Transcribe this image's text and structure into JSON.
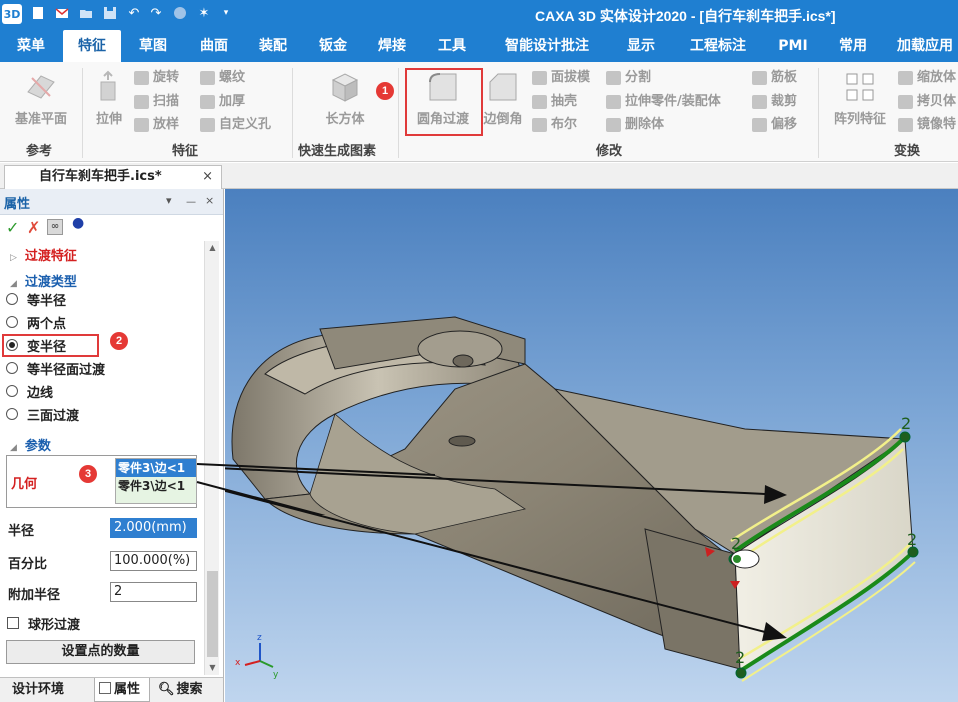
{
  "window": {
    "title": "CAXA 3D 实体设计2020 - [自行车刹车把手.ics*]"
  },
  "quick_access": [
    "new-doc-icon",
    "mail-icon",
    "open-folder-icon",
    "save-icon",
    "undo-icon",
    "redo-icon",
    "globe-icon",
    "sparkle-icon",
    "dropdown-icon"
  ],
  "menu_tabs": [
    {
      "label": "菜单"
    },
    {
      "label": "特征"
    },
    {
      "label": "草图"
    },
    {
      "label": "曲面"
    },
    {
      "label": "装配"
    },
    {
      "label": "钣金"
    },
    {
      "label": "焊接"
    },
    {
      "label": "工具"
    },
    {
      "label": "智能设计批注"
    },
    {
      "label": "显示"
    },
    {
      "label": "工程标注"
    },
    {
      "label": "PMI"
    },
    {
      "label": "常用"
    },
    {
      "label": "加载应用"
    }
  ],
  "active_tab": "特征",
  "ribbon": {
    "reference": {
      "group": "参考",
      "base_plane": "基准平面"
    },
    "feature": {
      "group": "特征",
      "extrude": "拉伸",
      "revolve": "旋转",
      "sweep": "扫描",
      "loft": "放样",
      "thread": "螺纹",
      "thicken": "加厚",
      "custom_hole": "自定义孔"
    },
    "quick": {
      "group": "快速生成图素",
      "box": "长方体"
    },
    "modify": {
      "group": "修改",
      "fillet": "圆角过渡",
      "chamfer": "边倒角",
      "draft": "面拔模",
      "shell": "抽壳",
      "boolean": "布尔",
      "split": "分割",
      "extrude_part": "拉伸零件/装配体",
      "delete_body": "删除体",
      "rib": "筋板",
      "trim": "裁剪",
      "offset": "偏移"
    },
    "transform": {
      "group": "变换",
      "pattern": "阵列特征",
      "scale": "缩放体",
      "copy": "拷贝体",
      "mirror": "镜像特"
    }
  },
  "document_tab": {
    "label": "自行车刹车把手.ics*",
    "close": "×"
  },
  "panel": {
    "title": "属性",
    "controls": [
      "▾",
      "ᅳ",
      "×"
    ],
    "fillet_feature": "过渡特征",
    "fillet_type_section": "过渡类型",
    "fillet_types": [
      {
        "label": "等半径",
        "selected": false
      },
      {
        "label": "两个点",
        "selected": false
      },
      {
        "label": "变半径",
        "selected": true
      },
      {
        "label": "等半径面过渡",
        "selected": false
      },
      {
        "label": "边线",
        "selected": false
      },
      {
        "label": "三面过渡",
        "selected": false
      }
    ],
    "params_section": "参数",
    "geometry_label": "几何",
    "geometry_items": [
      "零件3\\边<1",
      "零件3\\边<1"
    ],
    "radius_label": "半径",
    "radius_value": "2.000(mm)",
    "percent_label": "百分比",
    "percent_value": "100.000(%)",
    "extra_radius_label": "附加半径",
    "extra_radius_value": "2",
    "spherical_label": "球形过渡",
    "set_points_button": "设置点的数量",
    "bottom_tabs": [
      "设计环境",
      "属性",
      "搜索"
    ]
  },
  "badges": [
    "1",
    "2",
    "3"
  ],
  "viewport": {
    "edge_point_labels": [
      "2",
      "2",
      "2",
      "2"
    ],
    "axis_labels": {
      "x": "x",
      "y": "y",
      "z": "z"
    }
  },
  "colors": {
    "titlebar": "#1f7fd1",
    "highlight_red": "#e03a3a",
    "edge_green": "#1a8a1a",
    "edge_yellow": "#f2f08a"
  }
}
